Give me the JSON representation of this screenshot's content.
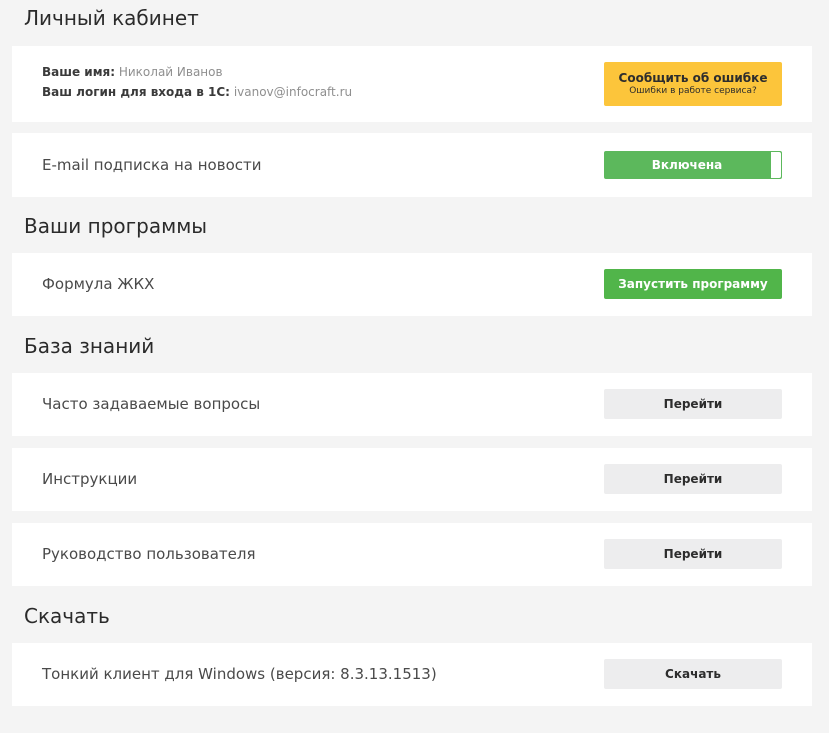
{
  "profile": {
    "title": "Личный кабинет",
    "name_label": "Ваше имя:",
    "name_value": "Николай Иванов",
    "login_label": "Ваш логин для входа в 1С:",
    "login_value": "ivanov@infocraft.ru",
    "report_button_main": "Сообщить об ошибке",
    "report_button_sub": "Ошибки в работе сервиса?"
  },
  "subscription": {
    "label": "E-mail подписка на новости",
    "toggle_label": "Включена",
    "enabled": true
  },
  "programs": {
    "title": "Ваши программы",
    "items": [
      {
        "name": "Формула ЖКХ",
        "button": "Запустить программу"
      }
    ]
  },
  "knowledge": {
    "title": "База знаний",
    "items": [
      {
        "label": "Часто задаваемые вопросы",
        "button": "Перейти"
      },
      {
        "label": "Инструкции",
        "button": "Перейти"
      },
      {
        "label": "Руководство пользователя",
        "button": "Перейти"
      }
    ]
  },
  "download": {
    "title": "Скачать",
    "items": [
      {
        "label": "Тонкий клиент для Windows (версия: 8.3.13.1513)",
        "button": "Скачать"
      }
    ]
  },
  "colors": {
    "background": "#f4f4f4",
    "card": "#ffffff",
    "yellow_button": "#fcc53b",
    "green_button": "#51b54a",
    "toggle_on": "#5cb85c",
    "gray_button": "#ededee"
  }
}
